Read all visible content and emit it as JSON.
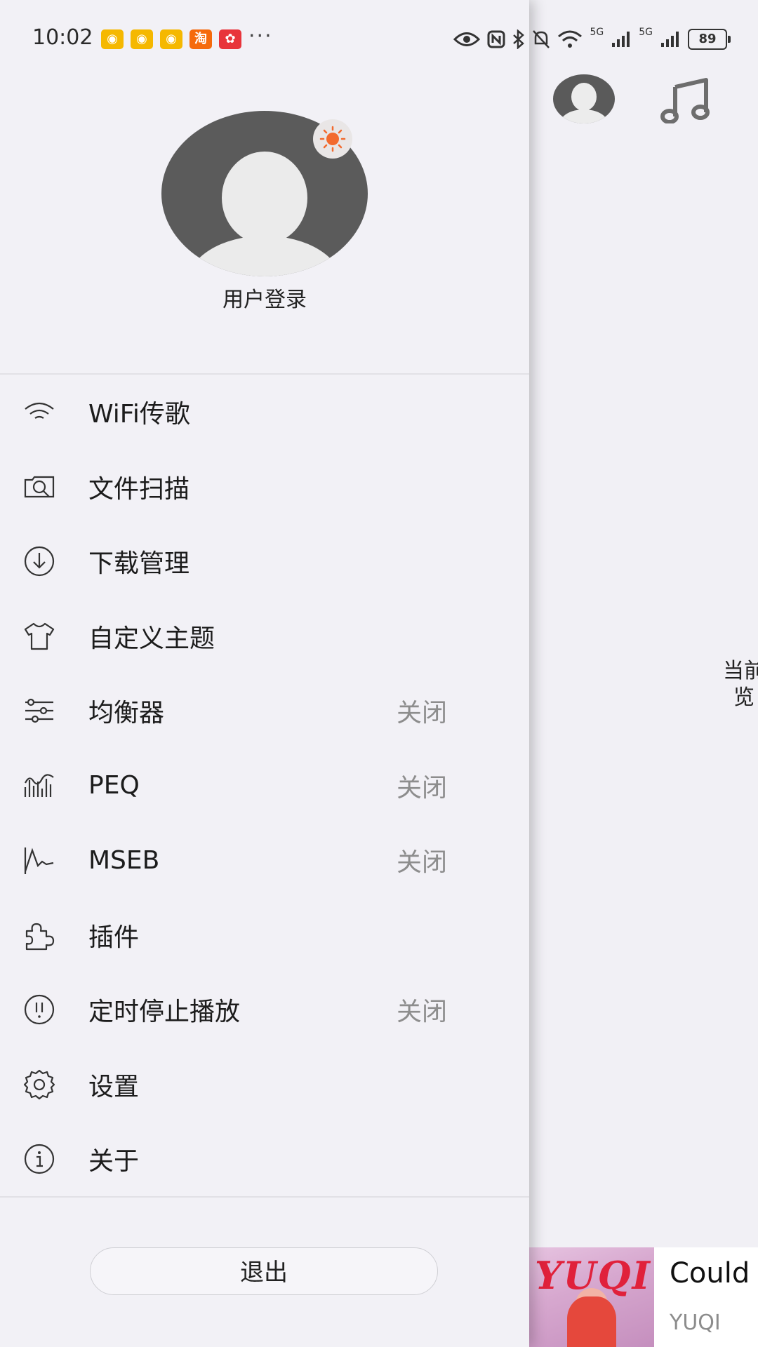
{
  "status_bar": {
    "time": "10:02",
    "notification_icons": [
      {
        "name": "weibo-icon",
        "color": "#f5b800"
      },
      {
        "name": "weibo-icon",
        "color": "#f5b800"
      },
      {
        "name": "weibo-icon",
        "color": "#f5b800"
      },
      {
        "name": "taobao-icon",
        "color": "#f56a0c",
        "text": "淘"
      },
      {
        "name": "app-icon",
        "color": "#e8343b"
      }
    ],
    "more": "···",
    "signal_left_label": "5G",
    "signal_right_label": "5G",
    "battery_level": "89"
  },
  "drawer": {
    "login_label": "用户登录",
    "menu_items": [
      {
        "label": "WiFi传歌",
        "icon": "wifi-icon",
        "status": ""
      },
      {
        "label": "文件扫描",
        "icon": "file-scan-icon",
        "status": ""
      },
      {
        "label": "下载管理",
        "icon": "download-icon",
        "status": ""
      },
      {
        "label": "自定义主题",
        "icon": "tshirt-icon",
        "status": ""
      },
      {
        "label": "均衡器",
        "icon": "equalizer-icon",
        "status": "关闭"
      },
      {
        "label": "PEQ",
        "icon": "peq-icon",
        "status": "关闭"
      },
      {
        "label": "MSEB",
        "icon": "mseb-icon",
        "status": "关闭"
      },
      {
        "label": "插件",
        "icon": "plugin-icon",
        "status": ""
      },
      {
        "label": "定时停止播放",
        "icon": "timer-icon",
        "status": "关闭"
      },
      {
        "label": "设置",
        "icon": "gear-icon",
        "status": ""
      },
      {
        "label": "关于",
        "icon": "info-icon",
        "status": ""
      }
    ],
    "logout_label": "退出",
    "accent_color": "#f26a2e"
  },
  "main": {
    "empty_text_line1": "当前",
    "empty_text_line2": "览",
    "now_playing": {
      "album_text": "YUQI",
      "title": "Could",
      "artist": "YUQI"
    }
  }
}
